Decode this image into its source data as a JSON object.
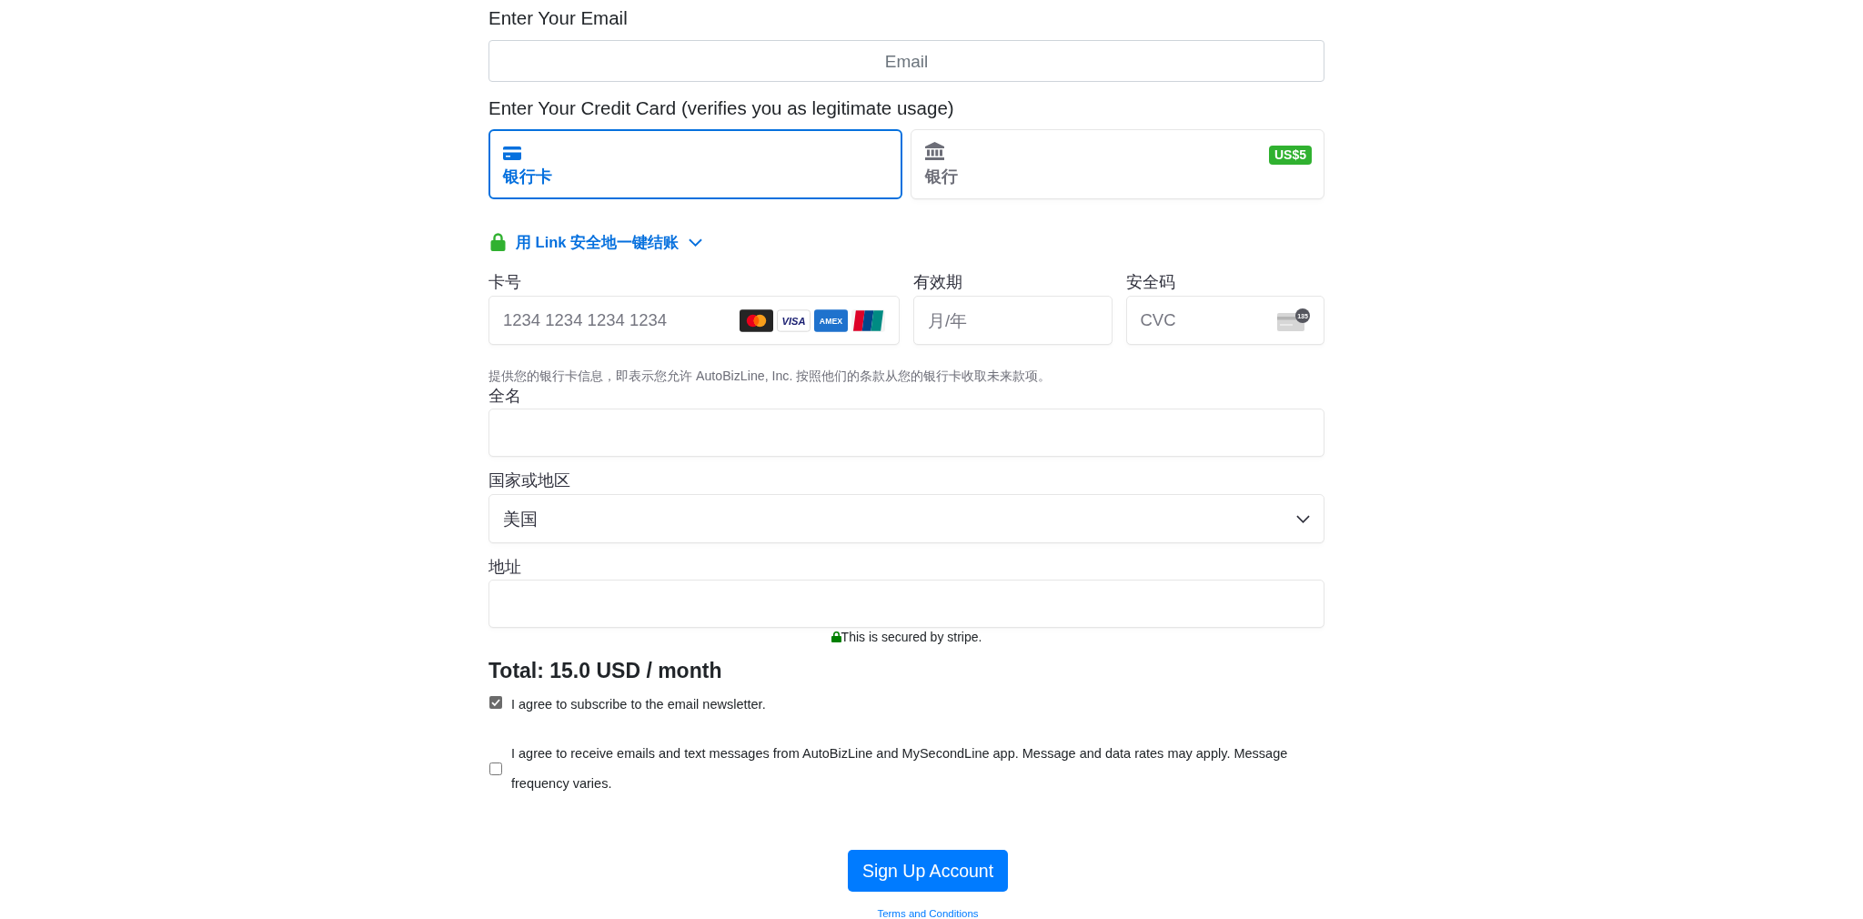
{
  "email": {
    "label": "Enter Your Email",
    "placeholder": "Email"
  },
  "card_section": {
    "label": "Enter Your Credit Card (verifies you as legitimate usage)"
  },
  "payment_tabs": [
    {
      "kind": "card",
      "label": "银行卡",
      "selected": true
    },
    {
      "kind": "bank",
      "label": "银行",
      "selected": false,
      "badge": "US$5"
    }
  ],
  "link_option": {
    "label": "用 Link 安全地一键结账"
  },
  "card_fields": [
    {
      "kind": "number",
      "label": "卡号",
      "placeholder": "1234 1234 1234 1234"
    },
    {
      "kind": "expiry",
      "label": "有效期",
      "placeholder": "月/年"
    },
    {
      "kind": "cvc",
      "label": "安全码",
      "placeholder": "CVC",
      "hint": "135"
    }
  ],
  "card_brands": [
    {
      "kind": "mastercard"
    },
    {
      "kind": "visa",
      "label": "VISA"
    },
    {
      "kind": "amex",
      "label": "AMEX"
    },
    {
      "kind": "unionpay"
    }
  ],
  "mandate_text": "提供您的银行卡信息，即表示您允许 AutoBizLine, Inc. 按照他们的条款从您的银行卡收取未来款项。",
  "name_field": {
    "label": "全名"
  },
  "country_field": {
    "label": "国家或地区",
    "value": "美国"
  },
  "address_field": {
    "label": "地址"
  },
  "security_note": "This is secured by stripe.",
  "total": "Total: 15.0 USD / month",
  "agreements": [
    {
      "text": "I agree to subscribe to the email newsletter.",
      "checked": true
    },
    {
      "text": "I agree to receive emails and text messages from AutoBizLine and MySecondLine app. Message and data rates may apply. Message frequency varies.",
      "checked": false
    }
  ],
  "submit_button": "Sign Up Account",
  "terms_link": "Terms and Conditions"
}
